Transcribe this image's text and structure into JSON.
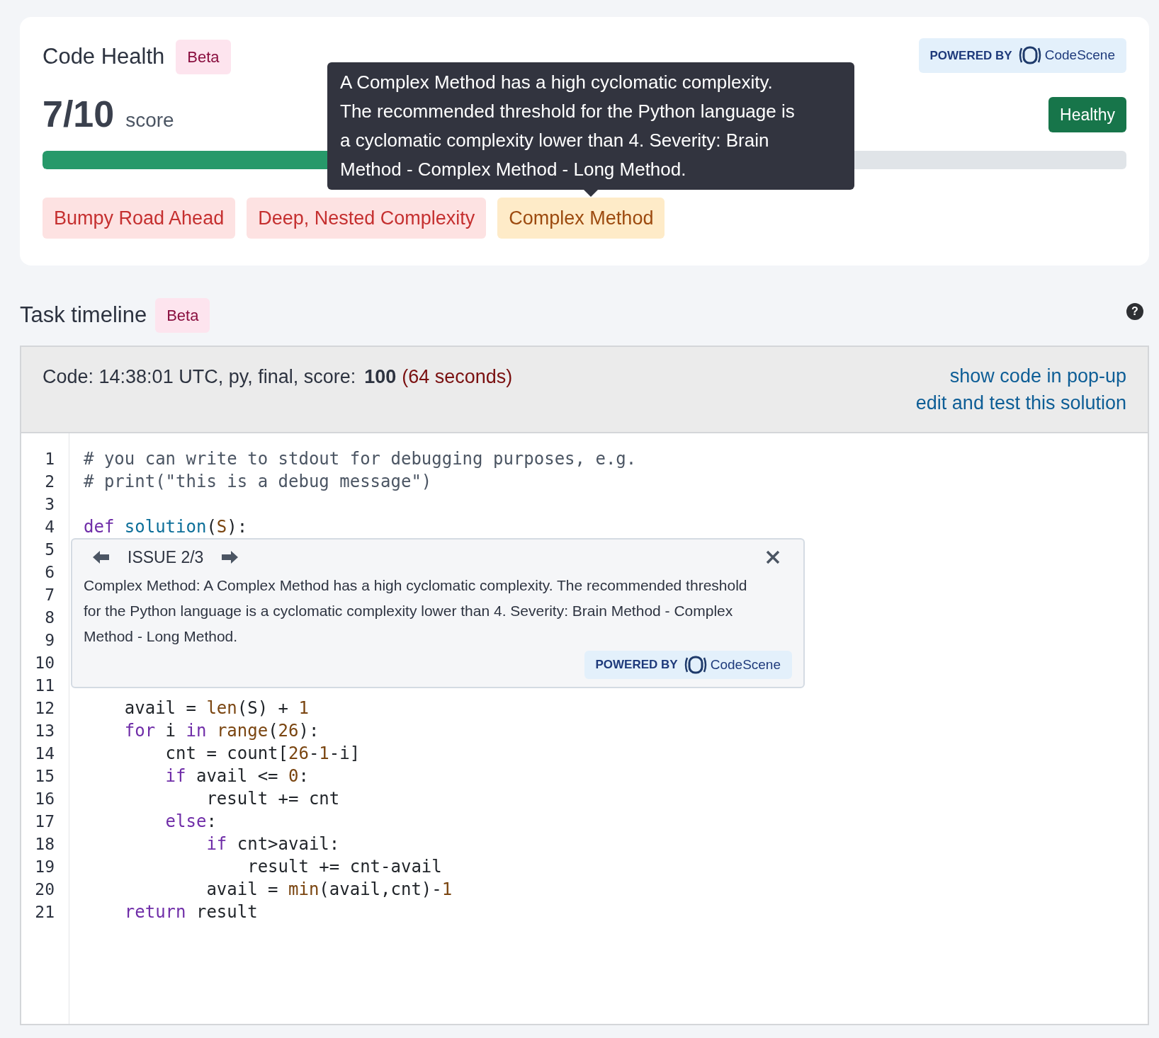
{
  "code_health": {
    "title": "Code Health",
    "badge": "Beta",
    "powered_by": {
      "label": "POWERED BY",
      "brand": "CodeScene"
    },
    "score": "7/10",
    "score_label": "score",
    "status": "Healthy",
    "level": 0.7,
    "tooltip": "A Complex Method has a high cyclomatic complexity. The recommended threshold for the Python language is a cyclomatic complexity lower than 4. Severity: Brain Method - Complex Method - Long Method.",
    "issues": [
      {
        "label": "Bumpy Road Ahead",
        "kind": "danger"
      },
      {
        "label": "Deep, Nested Complexity",
        "kind": "danger"
      },
      {
        "label": "Complex Method",
        "kind": "warning"
      }
    ]
  },
  "task_timeline": {
    "title": "Task timeline",
    "badge": "Beta",
    "help": "?",
    "header": {
      "info": "Code: 14:38:01 UTC, py, final, score:",
      "score": "100",
      "duration": "(64 seconds)",
      "links": [
        "show code in pop-up",
        "edit and test this solution"
      ]
    },
    "code_lines": [
      {
        "number": "1",
        "tokens": [
          {
            "kind": "comment",
            "text": "# you can write to stdout for debugging purposes, e.g."
          }
        ]
      },
      {
        "number": "2",
        "tokens": [
          {
            "kind": "comment",
            "text": "# print(\"this is a debug message\")"
          }
        ]
      },
      {
        "number": "3"
      },
      {
        "number": "4",
        "tokens": [
          {
            "kind": "keyword",
            "text": "def "
          },
          {
            "kind": "function",
            "text": "solution"
          },
          {
            "kind": "plain",
            "text": "("
          },
          {
            "kind": "builtin",
            "text": "S"
          },
          {
            "kind": "plain",
            "text": "):"
          }
        ]
      },
      {
        "number": "5"
      },
      {
        "number": "6"
      },
      {
        "number": "7"
      },
      {
        "number": "8"
      },
      {
        "number": "9"
      },
      {
        "number": "10"
      },
      {
        "number": "11"
      },
      {
        "number": "12",
        "tokens": [
          {
            "kind": "plain",
            "text": "    avail = "
          },
          {
            "kind": "builtin",
            "text": "len"
          },
          {
            "kind": "plain",
            "text": "(S) + "
          },
          {
            "kind": "number",
            "text": "1"
          }
        ]
      },
      {
        "number": "13",
        "tokens": [
          {
            "kind": "keyword",
            "text": "    for"
          },
          {
            "kind": "plain",
            "text": " i "
          },
          {
            "kind": "keyword",
            "text": "in "
          },
          {
            "kind": "builtin",
            "text": "range"
          },
          {
            "kind": "plain",
            "text": "("
          },
          {
            "kind": "number",
            "text": "26"
          },
          {
            "kind": "plain",
            "text": "):"
          }
        ]
      },
      {
        "number": "14",
        "tokens": [
          {
            "kind": "plain",
            "text": "        cnt = count["
          },
          {
            "kind": "number",
            "text": "26"
          },
          {
            "kind": "plain",
            "text": "-"
          },
          {
            "kind": "number",
            "text": "1"
          },
          {
            "kind": "plain",
            "text": "-i]"
          }
        ]
      },
      {
        "number": "15",
        "tokens": [
          {
            "kind": "keyword",
            "text": "        if"
          },
          {
            "kind": "plain",
            "text": " avail <= "
          },
          {
            "kind": "number",
            "text": "0"
          },
          {
            "kind": "plain",
            "text": ":"
          }
        ]
      },
      {
        "number": "16",
        "tokens": [
          {
            "kind": "plain",
            "text": "            result += cnt"
          }
        ]
      },
      {
        "number": "17",
        "tokens": [
          {
            "kind": "keyword",
            "text": "        else"
          },
          {
            "kind": "plain",
            "text": ":"
          }
        ]
      },
      {
        "number": "18",
        "tokens": [
          {
            "kind": "keyword",
            "text": "            if"
          },
          {
            "kind": "plain",
            "text": " cnt>avail:"
          }
        ]
      },
      {
        "number": "19",
        "tokens": [
          {
            "kind": "plain",
            "text": "                result += cnt-avail"
          }
        ]
      },
      {
        "number": "20",
        "tokens": [
          {
            "kind": "plain",
            "text": "            avail = "
          },
          {
            "kind": "builtin",
            "text": "min"
          },
          {
            "kind": "plain",
            "text": "(avail,cnt)-"
          },
          {
            "kind": "number",
            "text": "1"
          }
        ]
      },
      {
        "number": "21",
        "tokens": [
          {
            "kind": "keyword",
            "text": "    return"
          },
          {
            "kind": "plain",
            "text": " result"
          }
        ]
      }
    ],
    "issue_popup": {
      "title": "ISSUE 2/3",
      "text": "Complex Method: A Complex Method has a high cyclomatic complexity. The recommended threshold for the Python language is a cyclomatic complexity lower than 4. Severity: Brain Method - Complex Method - Long Method.",
      "powered_by": {
        "label": "POWERED BY",
        "brand": "CodeScene"
      }
    }
  }
}
